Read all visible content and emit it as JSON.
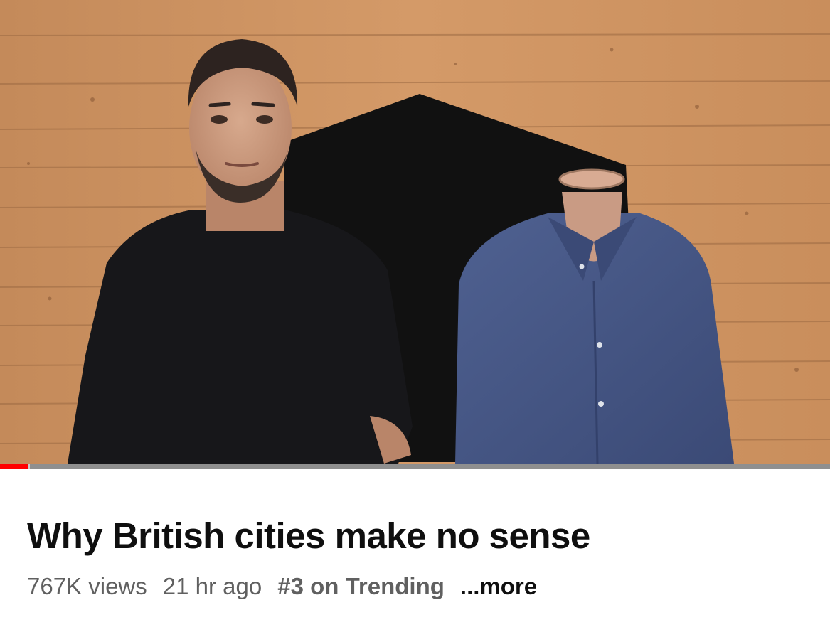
{
  "video": {
    "progress_played_fraction": 0.033,
    "progress_buffered_fraction": 0.036
  },
  "info": {
    "title": "Why British cities make no sense",
    "views": "767K views",
    "age": "21 hr ago",
    "trending": "#3 on Trending",
    "more": "...more"
  },
  "colors": {
    "progress_played": "#ff0000",
    "title": "#0f0f0f",
    "meta": "#606060"
  }
}
